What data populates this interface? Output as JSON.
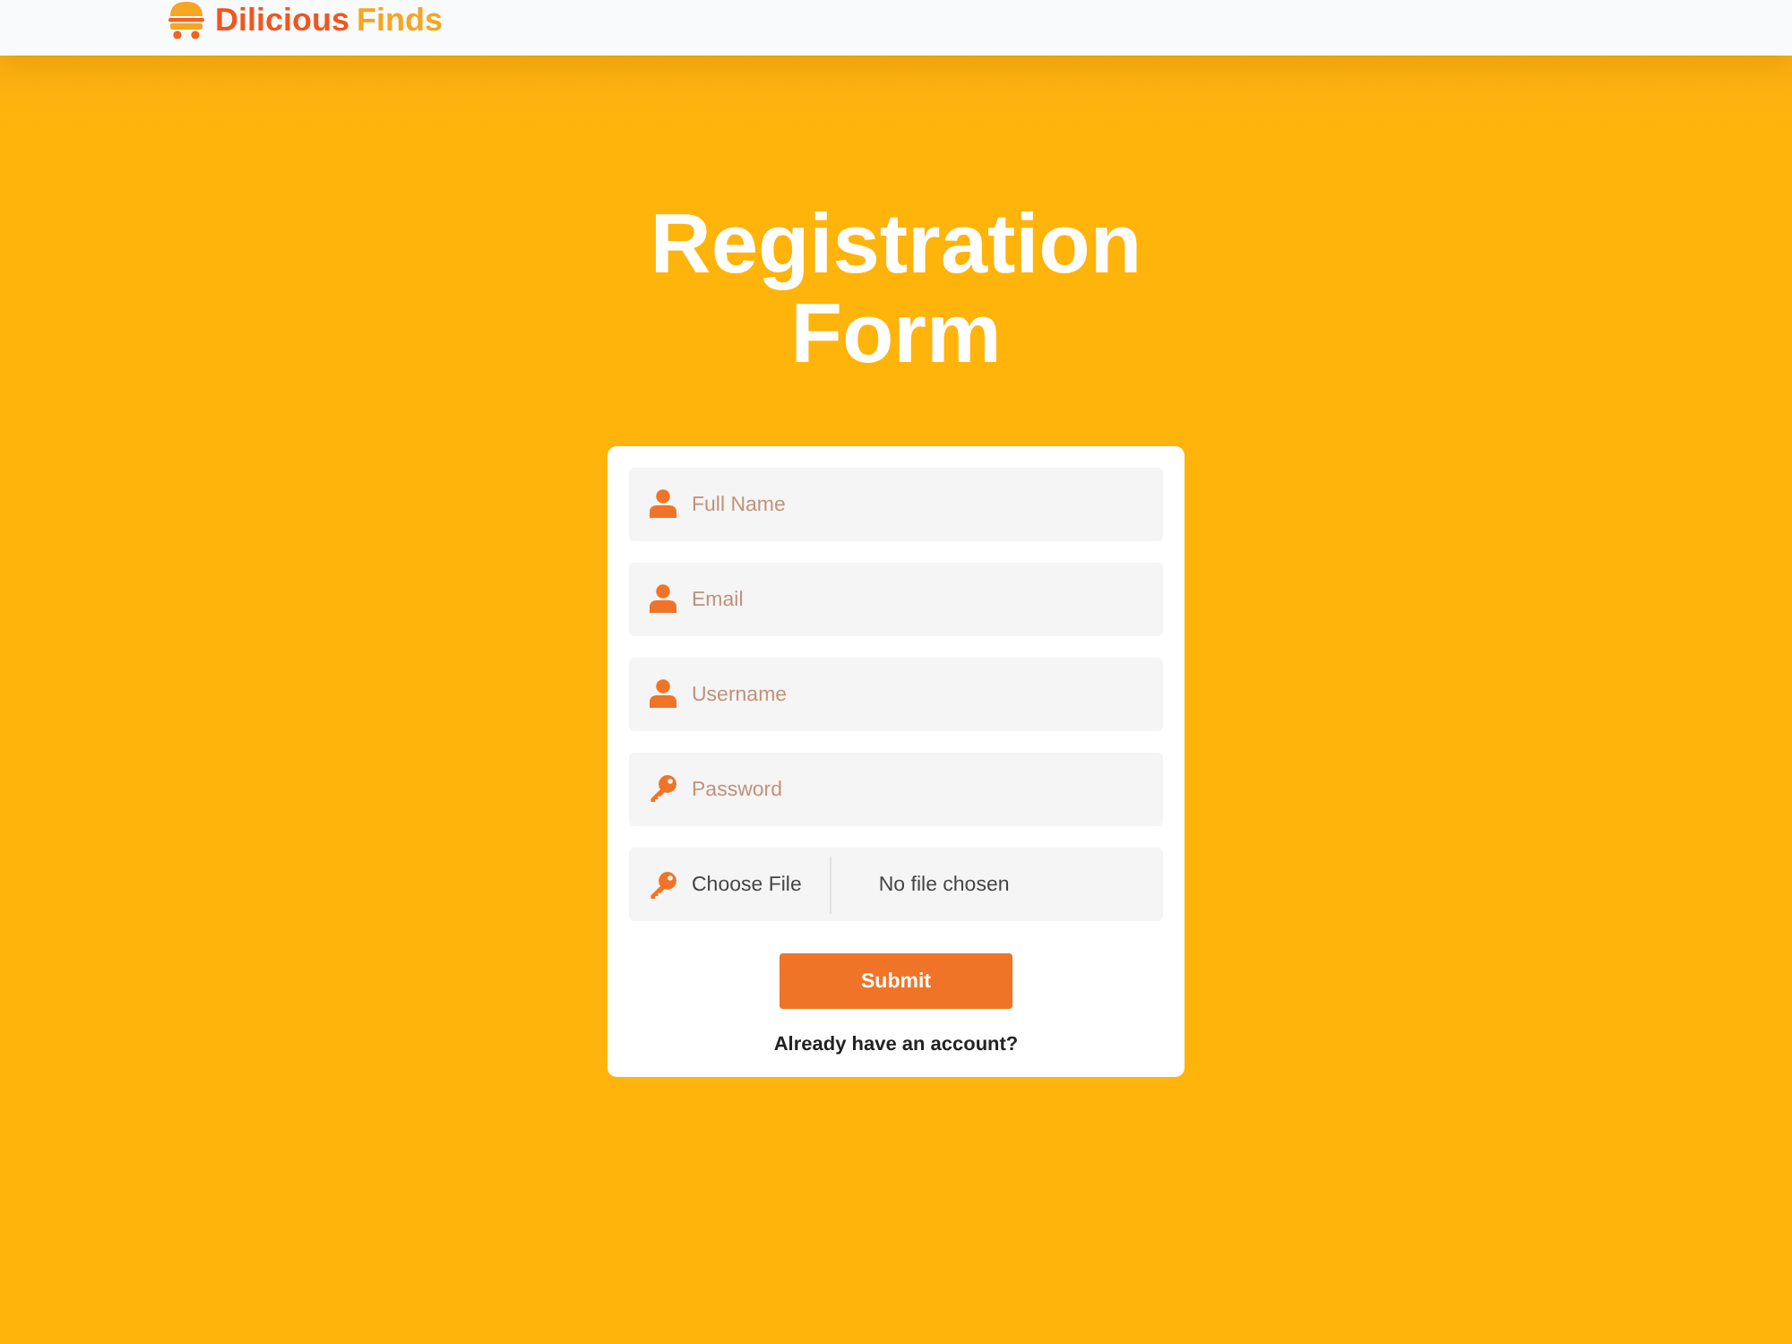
{
  "header": {
    "logo": {
      "name": "Dilicious",
      "accent": "Finds"
    }
  },
  "form": {
    "title": "Registration Form",
    "fields": [
      {
        "kind": "text",
        "placeholder": "Full Name"
      },
      {
        "kind": "text",
        "placeholder": "Email"
      },
      {
        "kind": "text",
        "placeholder": "Username"
      },
      {
        "kind": "password",
        "placeholder": "Password"
      },
      {
        "kind": "file",
        "button": "Choose File",
        "status": "No file chosen"
      }
    ],
    "submit": "Submit",
    "login_link": "Already have an account?"
  }
}
